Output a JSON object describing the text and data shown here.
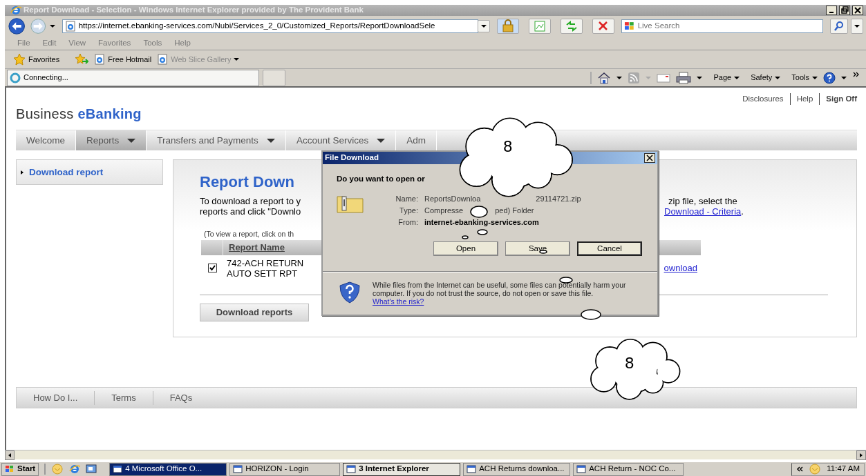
{
  "window": {
    "title": "Report Download - Selection - Windows Internet Explorer provided by The Provident Bank"
  },
  "browser": {
    "address": "https://internet.ebanking-services.com/Nubi/Services_2_0/Customized_Reports/ReportDownloadSele",
    "search": {
      "placeholder": "Live Search"
    },
    "menu": [
      "File",
      "Edit",
      "View",
      "Favorites",
      "Tools",
      "Help"
    ],
    "favorites": [
      {
        "label": "Favorites",
        "kind": "star"
      },
      {
        "label": "Free Hotmail",
        "kind": "page"
      },
      {
        "label": "Web Slice Gallery",
        "kind": "slice"
      }
    ],
    "tab": {
      "label": "Connecting..."
    },
    "commands": [
      "Page",
      "Safety",
      "Tools"
    ]
  },
  "page": {
    "brand": {
      "plain": "Business",
      "accent": "eBanking"
    },
    "top_links": [
      "Disclosures",
      "Help",
      "Sign Off"
    ],
    "nav": [
      {
        "label": "Welcome",
        "selected": false,
        "has_menu": false
      },
      {
        "label": "Reports",
        "selected": true,
        "has_menu": true
      },
      {
        "label": "Transfers and Payments",
        "selected": false,
        "has_menu": true
      },
      {
        "label": "Account Services",
        "selected": false,
        "has_menu": true
      },
      {
        "label": "Adm",
        "selected": false,
        "has_menu": false
      }
    ],
    "sidebar": {
      "items": [
        "Download report"
      ]
    },
    "heading": "Report Down",
    "intro_left": [
      "To download a report to y",
      "reports and click \"Downlo"
    ],
    "intro_right": "zip file, select the",
    "criteria_link": "Download - Criteria",
    "criteria_end": ".",
    "hint": "(To view a report, click on th",
    "table": {
      "columns": [
        "Report Name"
      ],
      "rows": [
        {
          "checked": true,
          "name": [
            "742-ACH RETURN",
            "AUTO SETT RPT"
          ],
          "link": "ownload"
        }
      ]
    },
    "download_button": "Download reports",
    "footer": [
      "How Do I...",
      "Terms",
      "FAQs"
    ]
  },
  "dialog": {
    "title": "File Download",
    "question": "Do you want to open or",
    "fields": [
      {
        "label": "Name:",
        "parts": [
          "ReportsDownloa",
          "29114721.zip"
        ],
        "bold": false
      },
      {
        "label": "Type:",
        "parts": [
          "Compresse",
          "ped) Folder"
        ],
        "bold": false
      },
      {
        "label": "From:",
        "parts": [
          "internet-ebanking-services.com"
        ],
        "bold": true
      }
    ],
    "buttons": [
      {
        "label": "Open",
        "default": false
      },
      {
        "label": "Save",
        "default": false
      },
      {
        "label": "Cancel",
        "default": true
      }
    ],
    "warning": "While files from the Internet can be useful, some files can potentially harm your computer. If you do not trust the source, do not open or save this file.",
    "risk_link": "What's the risk?"
  },
  "callouts": [
    {
      "label": "8"
    },
    {
      "label": "8"
    }
  ],
  "taskbar": {
    "start": "Start",
    "tasks": [
      {
        "label": "4 Microsoft Office O...",
        "selected": false,
        "flashing": true
      },
      {
        "label": "HORIZON - Login",
        "selected": false,
        "flashing": false
      },
      {
        "label": "3 Internet Explorer",
        "selected": true,
        "flashing": false
      },
      {
        "label": "ACH Returns downloa...",
        "selected": false,
        "flashing": false
      },
      {
        "label": "ACH Return - NOC Co...",
        "selected": false,
        "flashing": false
      }
    ],
    "clock": "11:47 AM"
  }
}
